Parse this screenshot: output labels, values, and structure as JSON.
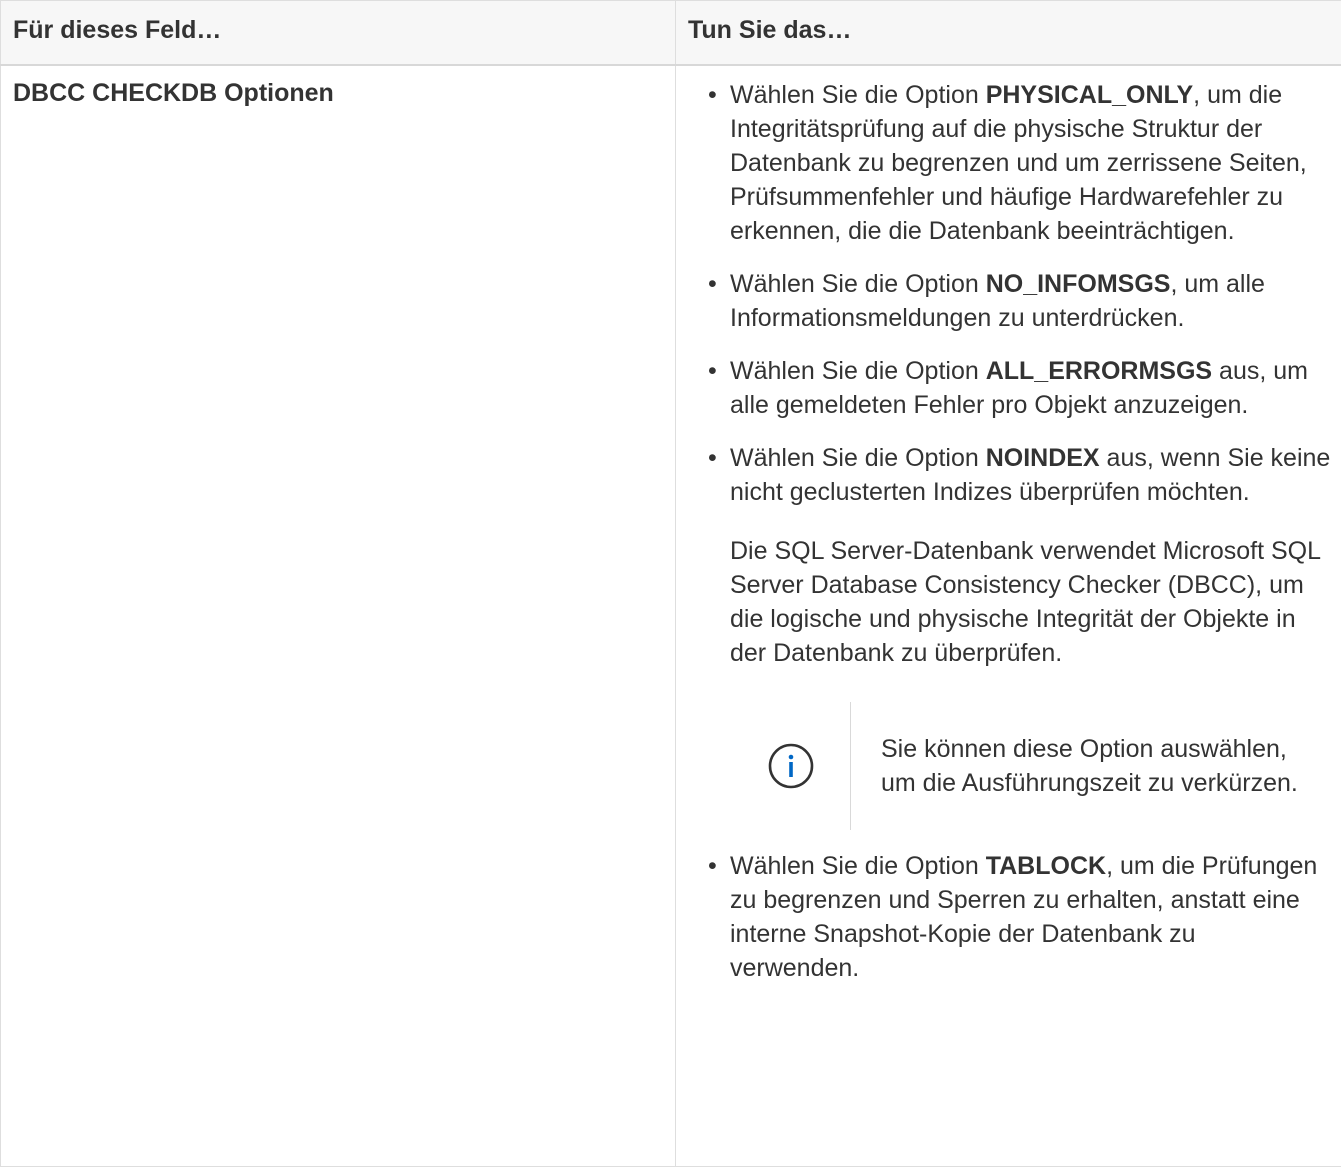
{
  "table": {
    "header": {
      "col1": "Für dieses Feld…",
      "col2": "Tun Sie das…"
    },
    "row": {
      "field": "DBCC CHECKDB Optionen",
      "options": [
        {
          "pre": "Wählen Sie die Option ",
          "bold": "PHYSICAL_ONLY",
          "post": ", um die Integritätsprüfung auf die physische Struktur der Datenbank zu begrenzen und um zerrissene Seiten, Prüfsummenfehler und häufige Hardwarefehler zu erkennen, die die Datenbank beeinträchtigen."
        },
        {
          "pre": "Wählen Sie die Option ",
          "bold": "NO_INFOMSGS",
          "post": ", um alle Informationsmeldungen zu unterdrücken."
        },
        {
          "pre": "Wählen Sie die Option ",
          "bold": "ALL_ERRORMSGS",
          "post": " aus, um alle gemeldeten Fehler pro Objekt anzuzeigen."
        },
        {
          "pre": "Wählen Sie die Option ",
          "bold": "NOINDEX",
          "post": " aus, wenn Sie keine nicht geclusterten Indizes überprüfen möchten.",
          "paragraph": "Die SQL Server-Datenbank verwendet Microsoft SQL Server Database Consistency Checker (DBCC), um die logische und physische Integrität der Objekte in der Datenbank zu überprüfen.",
          "note": "Sie können diese Option auswählen, um die Ausführungszeit zu verkürzen."
        },
        {
          "pre": "Wählen Sie die Option ",
          "bold": "TABLOCK",
          "post": ", um die Prüfungen zu begrenzen und Sperren zu erhalten, anstatt eine interne Snapshot-Kopie der Datenbank zu verwenden."
        }
      ]
    },
    "note_icon": "info-circle-icon",
    "colors": {
      "text": "#333333",
      "header_bg": "#f7f7f7",
      "border": "#dedede",
      "icon": "#0067c5"
    }
  }
}
